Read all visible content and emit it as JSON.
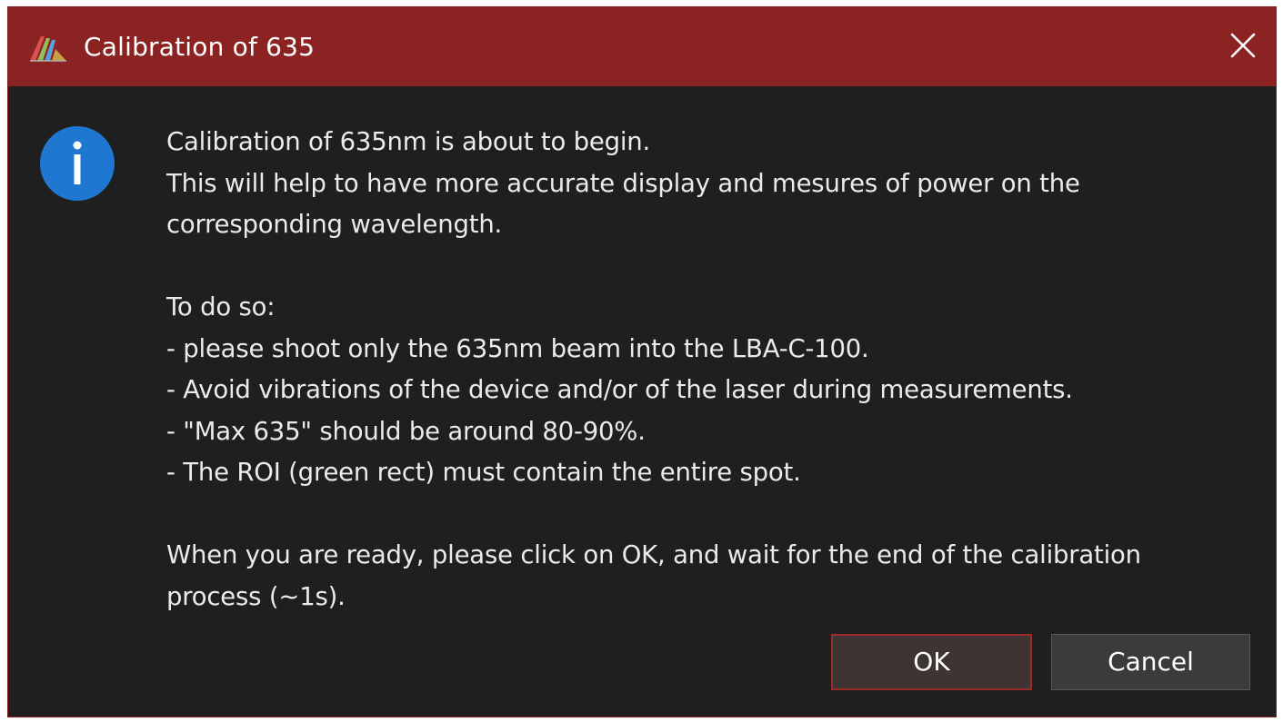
{
  "window": {
    "title": "Calibration of 635",
    "app_icon": "app-logo-icon",
    "close_icon": "close-icon",
    "colors": {
      "titlebar": "#8b2323",
      "background": "#1f1f1f",
      "text": "#ebebeb",
      "accent_border": "#9a2b2b",
      "info_icon": "#1e78d2"
    }
  },
  "message": {
    "icon": "info-icon",
    "lines": [
      "Calibration of 635nm is about to begin.",
      "This will help to have more accurate display and mesures of power on the",
      "corresponding wavelength.",
      "",
      "To do so:",
      "- please shoot only the 635nm beam into the LBA-C-100.",
      "- Avoid vibrations of the device and/or of the laser during measurements.",
      "- \"Max 635\" should be around 80-90%.",
      "- The ROI (green rect) must contain the entire spot.",
      "",
      "When you are ready, please click on OK, and wait for the end of the calibration",
      "process (~1s)."
    ]
  },
  "buttons": {
    "ok_label": "OK",
    "cancel_label": "Cancel"
  }
}
